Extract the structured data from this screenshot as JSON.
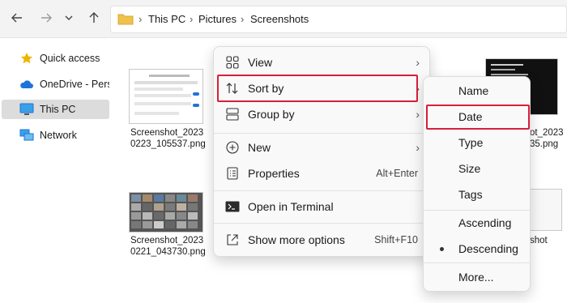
{
  "toolbar": {
    "back_icon": "arrow-left-icon",
    "forward_icon": "arrow-right-icon",
    "recent_icon": "chevron-down-icon",
    "up_icon": "arrow-up-icon",
    "breadcrumb": [
      "This PC",
      "Pictures",
      "Screenshots"
    ]
  },
  "sidebar": {
    "items": [
      {
        "label": "Quick access",
        "icon": "star-icon",
        "selected": false
      },
      {
        "label": "OneDrive - Perso",
        "icon": "cloud-icon",
        "selected": false
      },
      {
        "label": "This PC",
        "icon": "monitor-icon",
        "selected": true
      },
      {
        "label": "Network",
        "icon": "network-icon",
        "selected": false
      }
    ]
  },
  "files": [
    {
      "name_line1": "Screenshot_2023",
      "name_line2": "0223_105537.png"
    },
    {
      "name_line1": "Screenshot_2023",
      "name_line2": "0221_043730.png"
    },
    {
      "name_line1": "ot_2023",
      "name_line2": "35.png"
    },
    {
      "name_line1": "shot",
      "name_line2": ""
    }
  ],
  "context_menu": {
    "items": [
      {
        "label": "View",
        "icon": "view-grid-icon",
        "shortcut": "",
        "submenu": true
      },
      {
        "label": "Sort by",
        "icon": "sort-arrows-icon",
        "shortcut": "",
        "submenu": true,
        "highlighted": true
      },
      {
        "label": "Group by",
        "icon": "group-list-icon",
        "shortcut": "",
        "submenu": true
      },
      {
        "label": "New",
        "icon": "plus-circle-icon",
        "shortcut": "",
        "submenu": true
      },
      {
        "label": "Properties",
        "icon": "properties-icon",
        "shortcut": "Alt+Enter",
        "submenu": false
      },
      {
        "label": "Open in Terminal",
        "icon": "terminal-icon",
        "shortcut": "",
        "submenu": false
      },
      {
        "label": "Show more options",
        "icon": "share-external-icon",
        "shortcut": "Shift+F10",
        "submenu": false
      }
    ]
  },
  "sort_submenu": {
    "items": [
      "Name",
      "Date",
      "Type",
      "Size",
      "Tags"
    ],
    "highlighted": "Date",
    "order": [
      "Ascending",
      "Descending"
    ],
    "selected_order": "Descending",
    "more": "More..."
  },
  "colors": {
    "highlight_border": "#d6203a",
    "folder_yellow": "#f0c14b",
    "accent_blue": "#1e74d6"
  }
}
